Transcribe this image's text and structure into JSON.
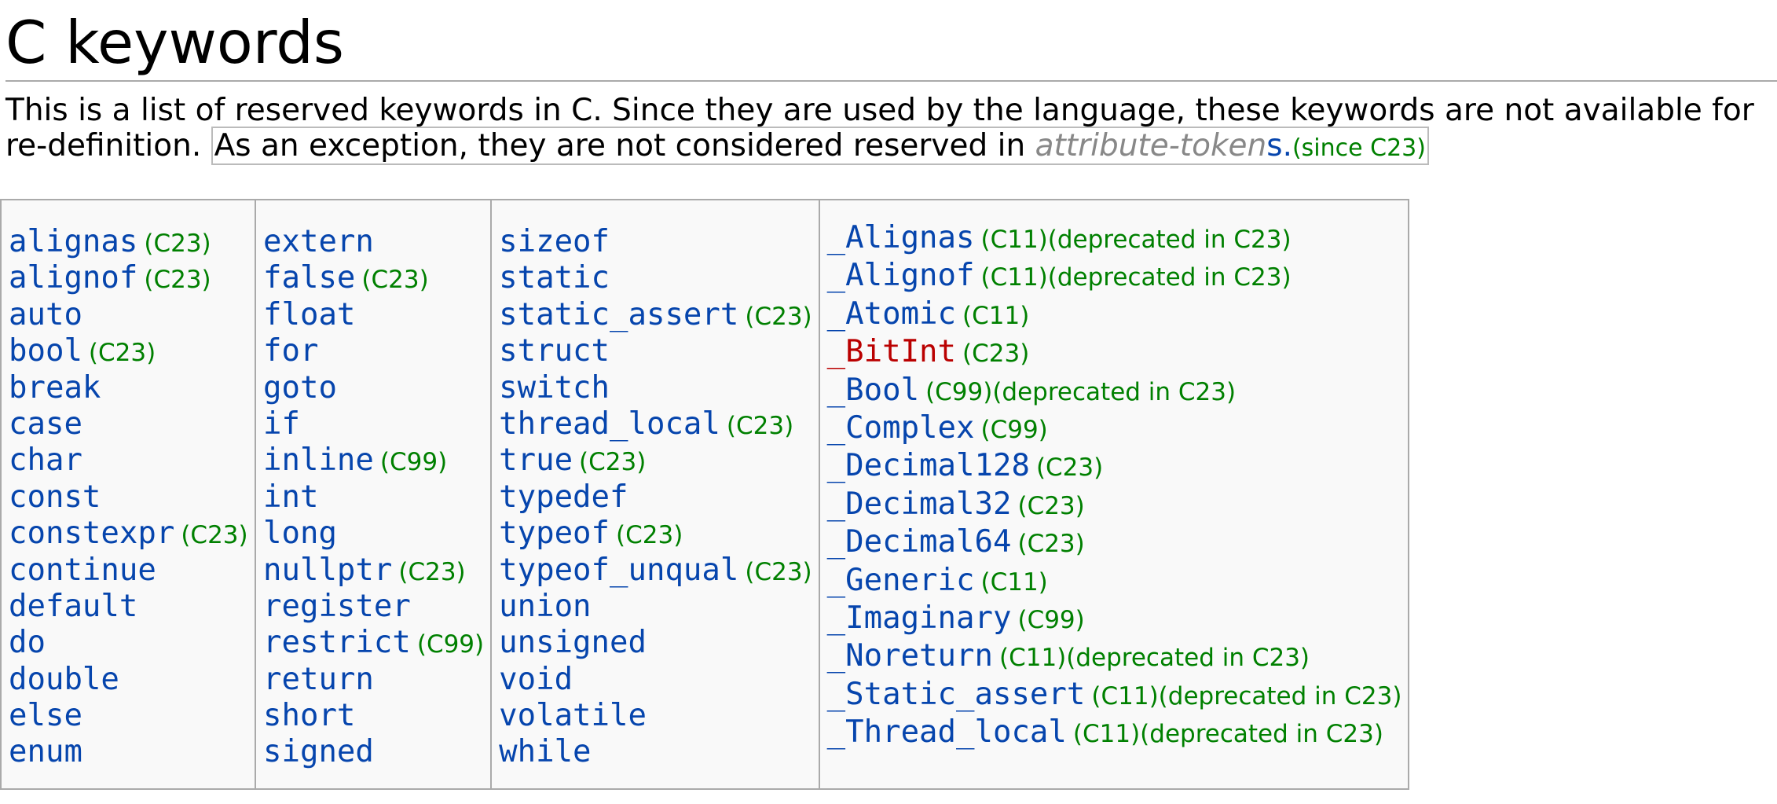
{
  "title": "C keywords",
  "intro": {
    "text": "This is a list of reserved keywords in C. Since they are used by the language, these keywords are not available for re-definition.",
    "note_prefix": "As an exception, they are not considered reserved in",
    "note_attr": "attribute-token",
    "note_tail": "s.",
    "note_since": "(since C23)"
  },
  "columns": [
    [
      {
        "kw": "alignas",
        "ver": "(C23)"
      },
      {
        "kw": "alignof",
        "ver": "(C23)"
      },
      {
        "kw": "auto",
        "ver": ""
      },
      {
        "kw": "bool",
        "ver": "(C23)"
      },
      {
        "kw": "break",
        "ver": ""
      },
      {
        "kw": "case",
        "ver": ""
      },
      {
        "kw": "char",
        "ver": ""
      },
      {
        "kw": "const",
        "ver": ""
      },
      {
        "kw": "constexpr",
        "ver": "(C23)"
      },
      {
        "kw": "continue",
        "ver": ""
      },
      {
        "kw": "default",
        "ver": ""
      },
      {
        "kw": "do",
        "ver": ""
      },
      {
        "kw": "double",
        "ver": ""
      },
      {
        "kw": "else",
        "ver": ""
      },
      {
        "kw": "enum",
        "ver": ""
      }
    ],
    [
      {
        "kw": "extern",
        "ver": ""
      },
      {
        "kw": "false",
        "ver": "(C23)"
      },
      {
        "kw": "float",
        "ver": ""
      },
      {
        "kw": "for",
        "ver": ""
      },
      {
        "kw": "goto",
        "ver": ""
      },
      {
        "kw": "if",
        "ver": ""
      },
      {
        "kw": "inline",
        "ver": "(C99)"
      },
      {
        "kw": "int",
        "ver": ""
      },
      {
        "kw": "long",
        "ver": ""
      },
      {
        "kw": "nullptr",
        "ver": "(C23)"
      },
      {
        "kw": "register",
        "ver": ""
      },
      {
        "kw": "restrict",
        "ver": "(C99)"
      },
      {
        "kw": "return",
        "ver": ""
      },
      {
        "kw": "short",
        "ver": ""
      },
      {
        "kw": "signed",
        "ver": ""
      }
    ],
    [
      {
        "kw": "sizeof",
        "ver": ""
      },
      {
        "kw": "static",
        "ver": ""
      },
      {
        "kw": "static_assert",
        "ver": "(C23)"
      },
      {
        "kw": "struct",
        "ver": ""
      },
      {
        "kw": "switch",
        "ver": ""
      },
      {
        "kw": "thread_local",
        "ver": "(C23)"
      },
      {
        "kw": "true",
        "ver": "(C23)"
      },
      {
        "kw": "typedef",
        "ver": ""
      },
      {
        "kw": "typeof",
        "ver": "(C23)"
      },
      {
        "kw": "typeof_unqual",
        "ver": "(C23)"
      },
      {
        "kw": "union",
        "ver": ""
      },
      {
        "kw": "unsigned",
        "ver": ""
      },
      {
        "kw": "void",
        "ver": ""
      },
      {
        "kw": "volatile",
        "ver": ""
      },
      {
        "kw": "while",
        "ver": ""
      }
    ],
    [
      {
        "kw": "_Alignas",
        "ver": "(C11)(deprecated in C23)"
      },
      {
        "kw": "_Alignof",
        "ver": "(C11)(deprecated in C23)"
      },
      {
        "kw": "_Atomic",
        "ver": "(C11)"
      },
      {
        "kw": "_BitInt",
        "ver": "(C23)",
        "new_page": true
      },
      {
        "kw": "_Bool",
        "ver": "(C99)(deprecated in C23)"
      },
      {
        "kw": "_Complex",
        "ver": "(C99)"
      },
      {
        "kw": "_Decimal128",
        "ver": "(C23)"
      },
      {
        "kw": "_Decimal32",
        "ver": "(C23)"
      },
      {
        "kw": "_Decimal64",
        "ver": "(C23)"
      },
      {
        "kw": "_Generic",
        "ver": "(C11)"
      },
      {
        "kw": "_Imaginary",
        "ver": "(C99)"
      },
      {
        "kw": "_Noreturn",
        "ver": "(C11)(deprecated in C23)"
      },
      {
        "kw": "_Static_assert",
        "ver": "(C11)(deprecated in C23)"
      },
      {
        "kw": "_Thread_local",
        "ver": "(C11)(deprecated in C23)"
      }
    ]
  ],
  "colors": {
    "link": "#0645ad",
    "new_link": "#ba0000",
    "version": "#008000",
    "border": "#aaaaaa",
    "table_bg": "#f9f9f9"
  }
}
